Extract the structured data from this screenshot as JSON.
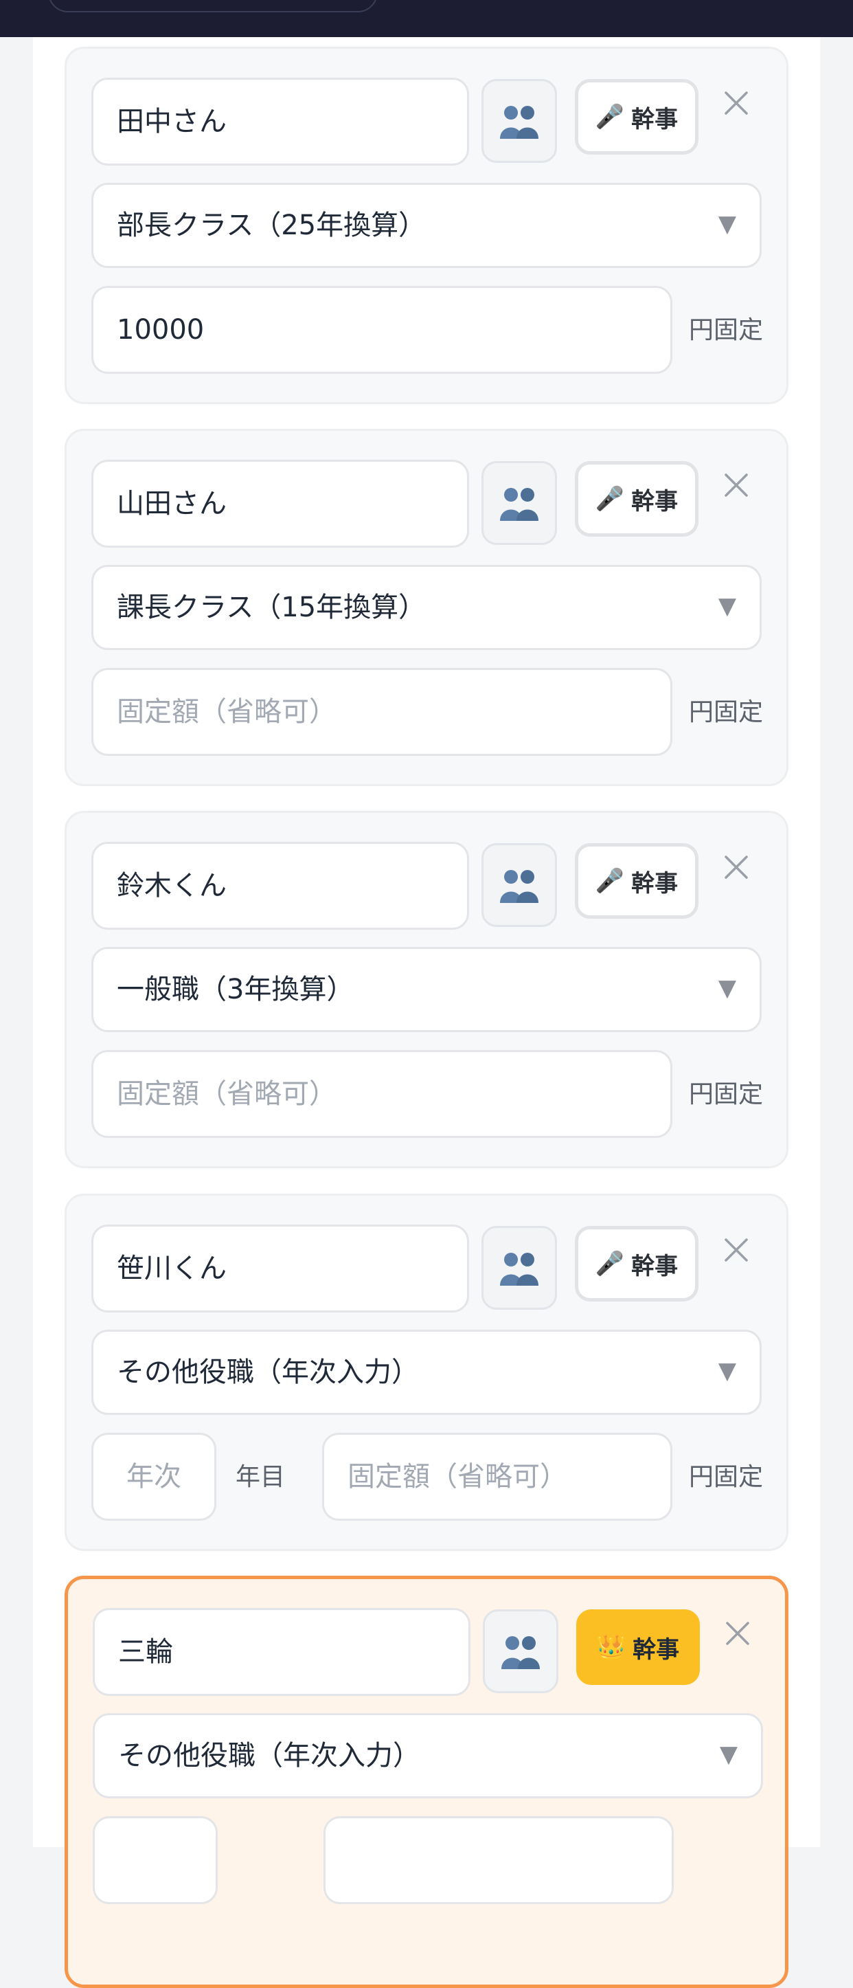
{
  "labels": {
    "kanji": "幹事",
    "yen_fixed": "円固定",
    "amount_placeholder": "固定額（省略可）",
    "year_placeholder": "年次",
    "year_suffix": "年目"
  },
  "members": [
    {
      "name": "田中さん",
      "role": "部長クラス（25年換算）",
      "amount": "10000",
      "organizer": false
    },
    {
      "name": "山田さん",
      "role": "課長クラス（15年換算）",
      "amount": "",
      "organizer": false
    },
    {
      "name": "鈴木くん",
      "role": "一般職（3年換算）",
      "amount": "",
      "organizer": false
    },
    {
      "name": "笹川くん",
      "role": "その他役職（年次入力）",
      "amount": "",
      "organizer": false
    },
    {
      "name": "三輪",
      "role": "その他役職（年次入力）",
      "amount": "",
      "organizer": true
    }
  ],
  "colors": {
    "organizer_active": "#fbbf24",
    "highlight_border": "#f6964a",
    "highlight_bg": "#fff4ea",
    "topbar": "#1c1d33"
  },
  "icons": {
    "group": "two-people-silhouette-icon",
    "mic": "microphone-icon",
    "crown": "crown-icon",
    "close": "close-icon",
    "caret": "chevron-down-icon"
  }
}
